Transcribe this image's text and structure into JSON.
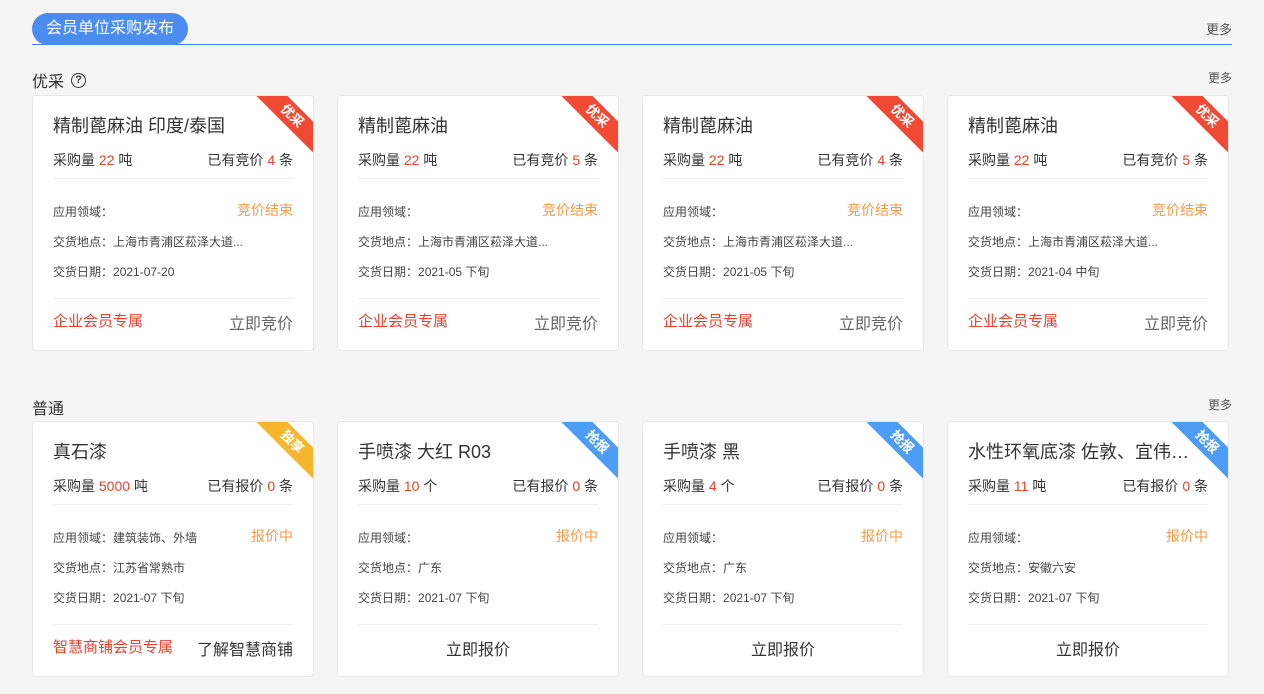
{
  "header": {
    "title": "会员单位采购发布",
    "more": "更多"
  },
  "sections": {
    "youcai": {
      "title": "优采",
      "more": "更多"
    },
    "putong": {
      "title": "普通",
      "more": "更多"
    }
  },
  "labels": {
    "qty": "采购量",
    "field": "应用领域：",
    "place": "交货地点：",
    "date": "交货日期："
  },
  "youcai_cards": [
    {
      "ribbon": "优采",
      "name": "精制蓖麻油 印度/泰国",
      "qty": "22",
      "unit": "吨",
      "bids_label": "已有竞价",
      "bids": "4",
      "bids_unit": "条",
      "field": "",
      "status": "竞价结束",
      "place": "上海市青浦区菘泽大道...",
      "date": "2021-07-20",
      "member": "企业会员专属",
      "action": "立即竞价"
    },
    {
      "ribbon": "优采",
      "name": "精制蓖麻油",
      "qty": "22",
      "unit": "吨",
      "bids_label": "已有竞价",
      "bids": "5",
      "bids_unit": "条",
      "field": "",
      "status": "竞价结束",
      "place": "上海市青浦区菘泽大道...",
      "date": "2021-05 下旬",
      "member": "企业会员专属",
      "action": "立即竞价"
    },
    {
      "ribbon": "优采",
      "name": "精制蓖麻油",
      "qty": "22",
      "unit": "吨",
      "bids_label": "已有竞价",
      "bids": "4",
      "bids_unit": "条",
      "field": "",
      "status": "竞价结束",
      "place": "上海市青浦区菘泽大道...",
      "date": "2021-05 下旬",
      "member": "企业会员专属",
      "action": "立即竞价"
    },
    {
      "ribbon": "优采",
      "name": "精制蓖麻油",
      "qty": "22",
      "unit": "吨",
      "bids_label": "已有竞价",
      "bids": "5",
      "bids_unit": "条",
      "field": "",
      "status": "竞价结束",
      "place": "上海市青浦区菘泽大道...",
      "date": "2021-04 中旬",
      "member": "企业会员专属",
      "action": "立即竞价"
    }
  ],
  "putong_cards": [
    {
      "ribbon": "独享",
      "name": "真石漆",
      "qty": "5000",
      "unit": "吨",
      "bids_label": "已有报价",
      "bids": "0",
      "bids_unit": "条",
      "field": "建筑装饰、外墙",
      "status": "报价中",
      "place": "江苏省常熟市",
      "date": "2021-07 下旬",
      "member": "智慧商铺会员专属",
      "action": "了解智慧商铺"
    },
    {
      "ribbon": "抢报",
      "name": "手喷漆 大红 R03",
      "qty": "10",
      "unit": "个",
      "bids_label": "已有报价",
      "bids": "0",
      "bids_unit": "条",
      "field": "",
      "status": "报价中",
      "place": "广东",
      "date": "2021-07 下旬",
      "action": "立即报价"
    },
    {
      "ribbon": "抢报",
      "name": "手喷漆 黑",
      "qty": "4",
      "unit": "个",
      "bids_label": "已有报价",
      "bids": "0",
      "bids_unit": "条",
      "field": "",
      "status": "报价中",
      "place": "广东",
      "date": "2021-07 下旬",
      "action": "立即报价"
    },
    {
      "ribbon": "抢报",
      "name": "水性环氧底漆 佐敦、宜伟、…",
      "qty": "11",
      "unit": "吨",
      "bids_label": "已有报价",
      "bids": "0",
      "bids_unit": "条",
      "field": "",
      "status": "报价中",
      "place": "安徽六安",
      "date": "2021-07 下旬",
      "action": "立即报价"
    }
  ],
  "colors": {
    "accent": "#4a8cf0",
    "red": "#e8412c",
    "orange": "#f39a4a",
    "ribbon_red": "#f04a35",
    "ribbon_yellow": "#f5b62d",
    "ribbon_blue": "#4d9cf5"
  }
}
